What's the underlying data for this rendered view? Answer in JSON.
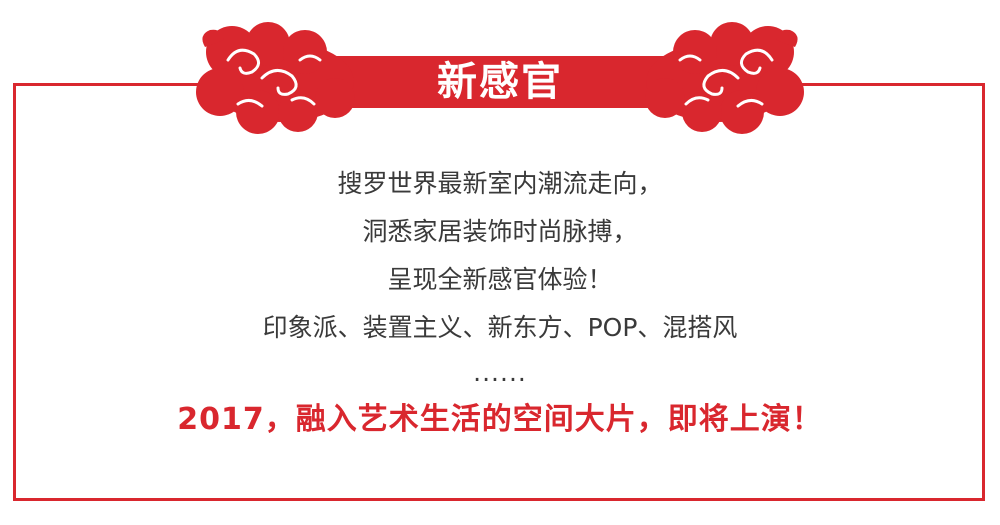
{
  "title": "新感官",
  "lines": [
    "搜罗世界最新室内潮流走向，",
    "洞悉家居装饰时尚脉搏，",
    "呈现全新感官体验！",
    "印象派、装置主义、新东方、POP、混搭风",
    "......"
  ],
  "highlight": "2017，融入艺术生活的空间大片，即将上演！",
  "colors": {
    "accent": "#d9272e",
    "text": "#3a3a3a",
    "background": "#ffffff"
  },
  "icons": [
    "cloud-ornament-left-icon",
    "cloud-ornament-right-icon"
  ]
}
